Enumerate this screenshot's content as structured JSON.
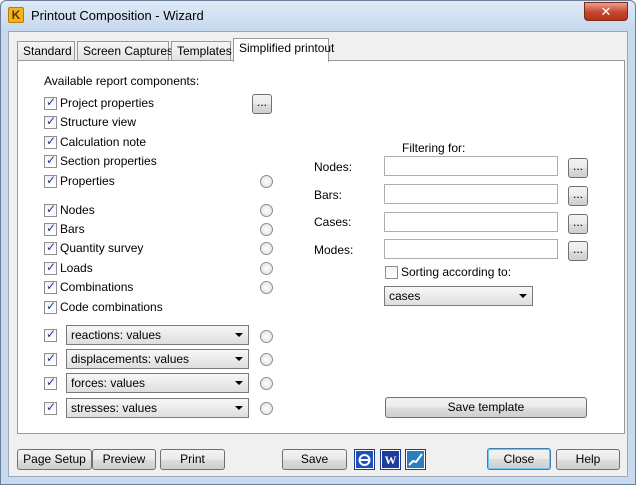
{
  "window": {
    "title": "Printout Composition - Wizard",
    "close_glyph": "✕",
    "icon_letter": "K"
  },
  "tabs": [
    "Standard",
    "Screen Captures",
    "Templates",
    "Simplified printout"
  ],
  "panel": {
    "heading": "Available report components:",
    "components": [
      {
        "label": "Project properties",
        "checked": true
      },
      {
        "label": "Structure view",
        "checked": true
      },
      {
        "label": "Calculation note",
        "checked": true
      },
      {
        "label": "Section properties",
        "checked": true
      },
      {
        "label": "Properties",
        "checked": true
      },
      {
        "label": "Nodes",
        "checked": true
      },
      {
        "label": "Bars",
        "checked": true
      },
      {
        "label": "Quantity survey",
        "checked": true
      },
      {
        "label": "Loads",
        "checked": true
      },
      {
        "label": "Combinations",
        "checked": true
      },
      {
        "label": "Code combinations",
        "checked": true
      }
    ],
    "ellipsis": "...",
    "result_selects": [
      {
        "value": "reactions: values",
        "checked": true
      },
      {
        "value": "displacements: values",
        "checked": true
      },
      {
        "value": "forces: values",
        "checked": true
      },
      {
        "value": "stresses: values",
        "checked": true
      }
    ],
    "filtering": {
      "heading": "Filtering for:",
      "fields": [
        {
          "label": "Nodes:",
          "value": ""
        },
        {
          "label": "Bars:",
          "value": ""
        },
        {
          "label": "Cases:",
          "value": ""
        },
        {
          "label": "Modes:",
          "value": ""
        }
      ],
      "sorting_label": "Sorting according to:",
      "sorting_checked": false,
      "sorting_value": "cases"
    },
    "save_template_label": "Save template"
  },
  "footer": {
    "page_setup": "Page Setup",
    "preview": "Preview",
    "print": "Print",
    "save": "Save",
    "close": "Close",
    "help": "Help",
    "icons": [
      "internet-explorer-icon",
      "word-icon",
      "chart-icon"
    ]
  }
}
